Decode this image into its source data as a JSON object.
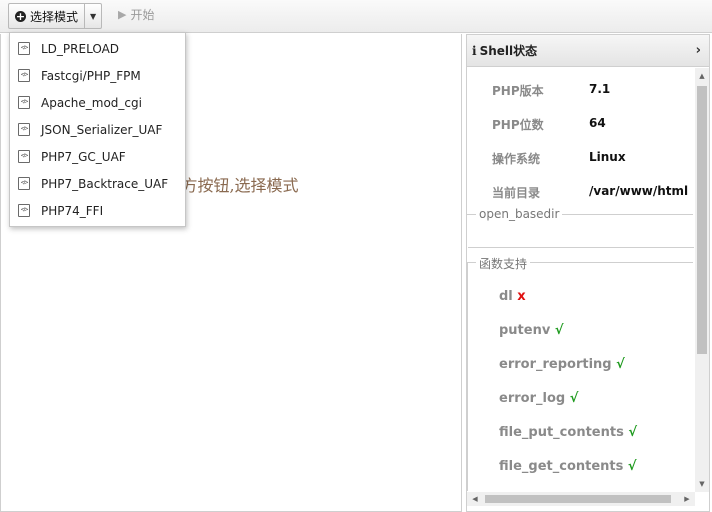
{
  "toolbar": {
    "mode_button_label": "选择模式",
    "start_label": "开始"
  },
  "menu": {
    "items": [
      {
        "label": "LD_PRELOAD",
        "icon": "php-file-icon"
      },
      {
        "label": "Fastcgi/PHP_FPM",
        "icon": "php-file-icon"
      },
      {
        "label": "Apache_mod_cgi",
        "icon": "php-file-icon"
      },
      {
        "label": "JSON_Serializer_UAF",
        "icon": "php-file-icon"
      },
      {
        "label": "PHP7_GC_UAF",
        "icon": "php-file-icon"
      },
      {
        "label": "PHP7_Backtrace_UAF",
        "icon": "php-file-icon"
      },
      {
        "label": "PHP74_FFI",
        "icon": "php-file-icon"
      }
    ]
  },
  "main": {
    "hint": "上方按钮,选择模式"
  },
  "shell_status": {
    "title": "Shell状态",
    "info": [
      {
        "key": "PHP版本",
        "value": "7.1"
      },
      {
        "key": "PHP位数",
        "value": "64"
      },
      {
        "key": "操作系统",
        "value": "Linux"
      },
      {
        "key": "当前目录",
        "value": "/var/www/html"
      }
    ],
    "open_basedir_label": "open_basedir",
    "functions_label": "函数支持",
    "functions": [
      {
        "name": "dl",
        "mark": "x",
        "supported": false
      },
      {
        "name": "putenv",
        "mark": "√",
        "supported": true
      },
      {
        "name": "error_reporting",
        "mark": "√",
        "supported": true
      },
      {
        "name": "error_log",
        "mark": "√",
        "supported": true
      },
      {
        "name": "file_put_contents",
        "mark": "√",
        "supported": true
      },
      {
        "name": "file_get_contents",
        "mark": "√",
        "supported": true
      }
    ]
  },
  "colors": {
    "supported": "#1e9a1e",
    "unsupported": "#e01010"
  }
}
